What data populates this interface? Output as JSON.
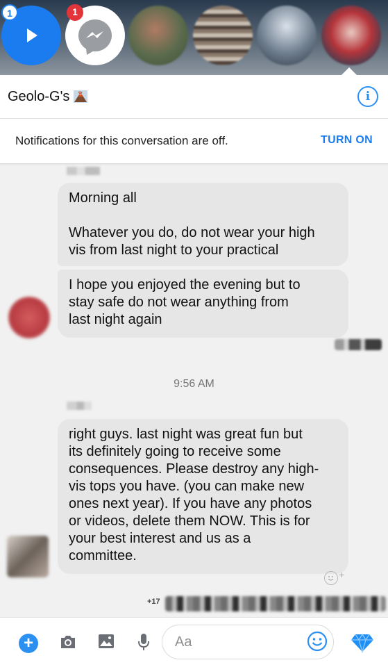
{
  "chat_heads": {
    "badge_first": "1",
    "badge_second": "1"
  },
  "conversation": {
    "title": "Geolo-G's",
    "title_emoji": "volcano-icon",
    "info_icon_label": "i"
  },
  "notification_bar": {
    "text": "Notifications for this conversation are off.",
    "action": "TURN ON"
  },
  "messages": {
    "first_group": [
      {
        "lines": [
          "Morning all"
        ]
      },
      {
        "lines": [
          "Whatever you do, do not wear your high",
          "vis from last night to your practical"
        ]
      },
      {
        "lines": [
          "I hope you enjoyed the evening but to",
          "stay safe do not wear anything from",
          "last night again"
        ]
      }
    ],
    "timestamp": "9:56 AM",
    "second_group": [
      {
        "lines": [
          "right guys. last night was great fun but",
          "its definitely going to receive some",
          "consequences. Please destroy any high-",
          "vis tops you have. (you can make new",
          "ones next year). If you have any photos",
          "or videos, delete them NOW. This is for",
          "your best interest and us as a",
          "committee."
        ]
      }
    ],
    "seen_count": "+17"
  },
  "composer": {
    "placeholder": "Aa"
  },
  "colors": {
    "accent": "#1b7cf0",
    "bubble": "#e6e6e6",
    "badge_red": "#e4343b"
  }
}
